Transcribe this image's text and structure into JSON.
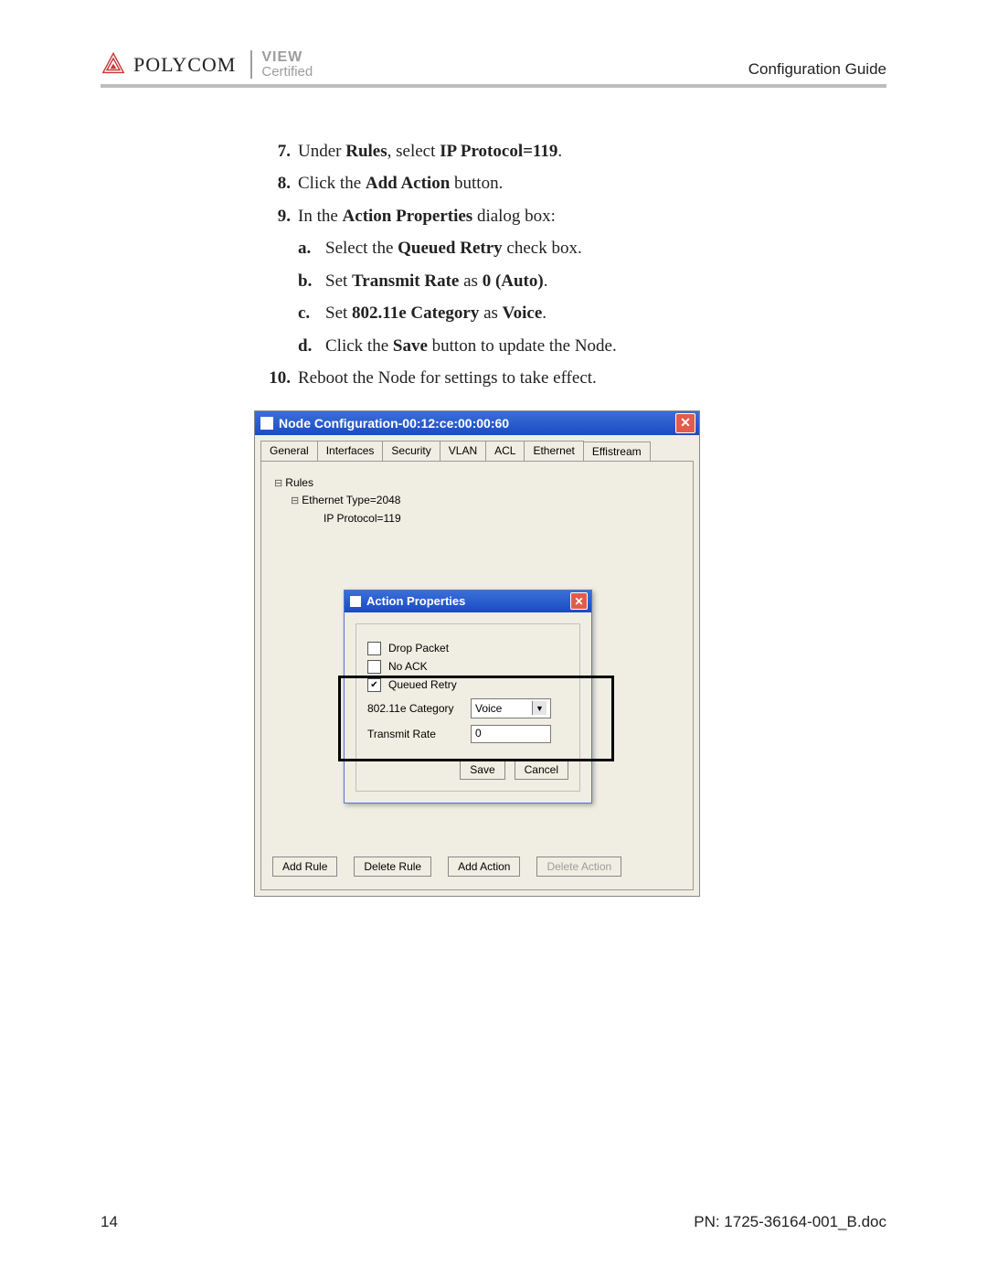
{
  "header": {
    "brand": "POLYCOM",
    "tagline_top": "VIEW",
    "tagline_bot": "Certified",
    "right": "Configuration Guide"
  },
  "steps": {
    "s7_pre": "Under ",
    "s7_b1": "Rules",
    "s7_mid": ", select ",
    "s7_b2": "IP Protocol=119",
    "s7_post": ".",
    "s8_pre": "Click the ",
    "s8_b": "Add Action",
    "s8_post": " button.",
    "s9_pre": "In the ",
    "s9_b": "Action Properties",
    "s9_post": " dialog box:",
    "a_pre": "Select the ",
    "a_b": "Queued Retry",
    "a_post": " check box.",
    "b_pre": "Set ",
    "b_b1": "Transmit Rate",
    "b_mid": " as ",
    "b_b2": "0 (Auto)",
    "b_post": ".",
    "c_pre": "Set ",
    "c_b1": "802.11e Category",
    "c_mid": " as ",
    "c_b2": "Voice",
    "c_post": ".",
    "d_pre": "Click the ",
    "d_b": "Save",
    "d_post": " button to update the Node.",
    "s10": "Reboot the Node for settings to take effect."
  },
  "num": {
    "n7": "7.",
    "n8": "8.",
    "n9": "9.",
    "n10": "10.",
    "a": "a.",
    "b": "b.",
    "c": "c.",
    "d": "d."
  },
  "outer": {
    "title": "Node Configuration-00:12:ce:00:00:60",
    "tabs": [
      "General",
      "Interfaces",
      "Security",
      "VLAN",
      "ACL",
      "Ethernet",
      "Effistream"
    ],
    "tree": {
      "root": "Rules",
      "child": "Ethernet Type=2048",
      "leaf": "IP Protocol=119"
    },
    "buttons": {
      "add_rule": "Add Rule",
      "del_rule": "Delete Rule",
      "add_action": "Add Action",
      "del_action": "Delete Action"
    }
  },
  "dlg": {
    "title": "Action Properties",
    "drop_packet": "Drop Packet",
    "no_ack": "No ACK",
    "queued_retry": "Queued Retry",
    "cat_label": "802.11e Category",
    "cat_value": "Voice",
    "rate_label": "Transmit Rate",
    "rate_value": "0",
    "save": "Save",
    "cancel": "Cancel"
  },
  "footer": {
    "page": "14",
    "pn": "PN: 1725-36164-001_B.doc"
  }
}
